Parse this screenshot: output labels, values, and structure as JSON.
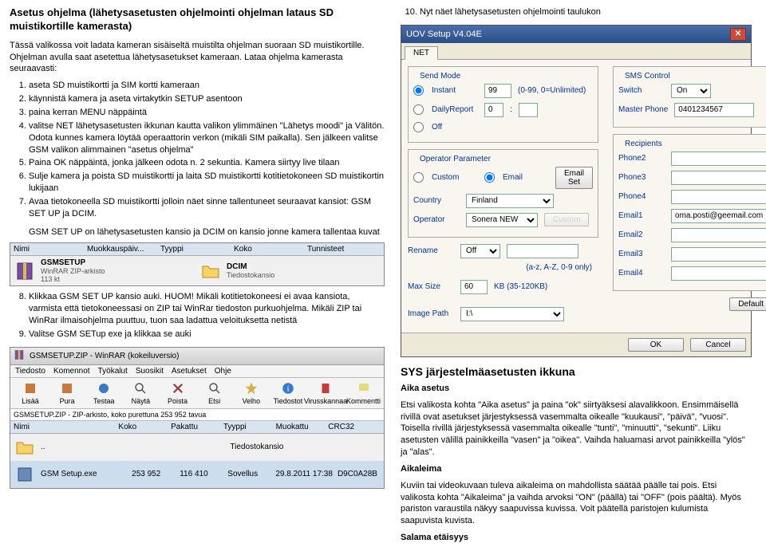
{
  "left": {
    "title": "Asetus ohjelma (lähetysasetusten ohjelmointi ohjelman lataus SD muistikortille kamerasta)",
    "intro": "Tässä valikossa voit ladata kameran sisäiseltä muistilta ohjelman suoraan SD muistikortille. Ohjelman avulla saat asetettua lähetysasetukset kameraan. Lataa ohjelma kamerasta seuraavasti:",
    "steps_a": [
      "aseta SD muistikortti ja SIM kortti kameraan",
      "käynnistä kamera ja aseta virtakytkin SETUP asentoon",
      "paina kerran MENU näppäintä",
      "valitse NET lähetysasetusten ikkunan kautta valikon ylimmäinen \"Lähetys moodi\" ja Välitön. Odota kunnes kamera löytää operaattorin verkon (mikäli SIM paikalla). Sen jälkeen valitse GSM valikon alimmainen \"asetus ohjelma\"",
      "Paina OK näppäintä, jonka jälkeen odota n. 2 sekuntia. Kamera siirtyy live tilaan",
      "Sulje kamera ja poista SD muistikortti ja laita SD muistikortti kotitietokoneen SD muistikortin lukijaan",
      "Avaa tietokoneella SD muistikortti jolloin näet sinne tallentuneet seuraavat kansiot: GSM SET UP ja DCIM."
    ],
    "note_a": "GSM SET UP on lähetysasetusten kansio ja DCIM on kansio jonne kamera tallentaa kuvat",
    "explorer1_cols": [
      "Nimi",
      "Muokkauspäiv...",
      "Tyyppi",
      "Koko",
      "Tunnisteet"
    ],
    "explorer1_rows": [
      {
        "icon": "zip",
        "name": "GSMSETUP",
        "sub1": "WinRAR ZIP-arkisto",
        "sub2": "113 kt"
      },
      {
        "icon": "folder",
        "name": "DCIM",
        "sub1": "Tiedostokansio",
        "sub2": ""
      }
    ],
    "steps_b": [
      "Klikkaa GSM SET UP kansio auki. HUOM! Mikäli kotitietokoneesi ei avaa kansiota, varmista että tietokoneessasi on ZIP tai WinRar tiedoston purkuohjelma. Mikäli ZIP tai WinRar ilmaisohjelma puuttuu, tuon saa ladattua veloituksetta netistä",
      "Valitse GSM SETup exe ja klikkaa se auki"
    ],
    "winrar": {
      "title": "GSMSETUP.ZIP - WinRAR (kokeiluversio)",
      "menu": [
        "Tiedosto",
        "Komennot",
        "Työkalut",
        "Suosikit",
        "Asetukset",
        "Ohje"
      ],
      "tools": [
        "Lisää",
        "Pura",
        "Testaa",
        "Näytä",
        "Poista",
        "Etsi",
        "Velho",
        "Tiedostot",
        "Virusskannaa",
        "Kommentti"
      ],
      "path": "GSMSETUP.ZIP - ZIP-arkisto, koko purettuna 253 952 tavua",
      "cols": [
        "Nimi",
        "Koko",
        "Pakattu",
        "Tyyppi",
        "Muokattu",
        "CRC32"
      ],
      "row_parent": "..",
      "row_parent_type": "Tiedostokansio",
      "row": {
        "name": "GSM Setup.exe",
        "size": "253 952",
        "packed": "116 410",
        "type": "Sovellus",
        "date": "29.8.2011 17:38",
        "crc": "D9C0A28B"
      }
    }
  },
  "right": {
    "step10": "Nyt näet lähetysasetusten ohjelmointi taulukon",
    "uov": {
      "title": "UOV Setup V4.04E",
      "tab": "NET",
      "send_mode_label": "Send Mode",
      "instant_label": "Instant",
      "instant_val": "99",
      "instant_hint": "(0-99, 0=Unlimited)",
      "daily_label": "DailyReport",
      "daily_val": "0",
      "off_label": "Off",
      "sms_group": "SMS Control",
      "switch_label": "Switch",
      "switch_val": "On",
      "master_label": "Master Phone",
      "master_val": "0401234567",
      "operator_group": "Operator Parameter",
      "custom": "Custom",
      "email": "Email",
      "email_set_btn": "Email Set",
      "country_label": "Country",
      "country_val": "Finland",
      "operator_label": "Operator",
      "operator_val": "Sonera NEW",
      "custom_btn": "Custom",
      "recipients_group": "Recipients",
      "phone2": "Phone2",
      "phone3": "Phone3",
      "phone4": "Phone4",
      "rename_label": "Rename",
      "rename_val": "Off",
      "email1": "Email1",
      "email1_val": "oma.posti@geemail.com",
      "note": "(a-z, A-Z, 0-9 only)",
      "email2": "Email2",
      "email3": "Email3",
      "maxsize_label": "Max Size",
      "maxsize_val": "60",
      "maxsize_unit": "KB   (35-120KB)",
      "email4": "Email4",
      "image_path_label": "Image Path",
      "image_path_val": "I:\\",
      "default_btn": "Default",
      "ok_btn": "OK",
      "cancel_btn": "Cancel"
    },
    "sys_title": "SYS järjestelmäasetusten ikkuna",
    "aika_head": "Aika asetus",
    "aika_body": "Etsi valikosta kohta \"Aika asetus\" ja paina \"ok\" siirtyäksesi alavalikkoon. Ensimmäisellä rivillä ovat asetukset järjestyksessä vasemmalta oikealle \"kuukausi\", \"päivä\", \"vuosi\". Toisella rivillä järjestyksessä vasemmalta oikealle \"tunti\", \"minuutti\", \"sekunti\". Liiku asetusten välillä painikkeilla \"vasen\" ja \"oikea\". Vaihda haluamasi arvot painikkeilla \"ylös\" ja \"alas\".",
    "aikaleima_head": "Aikaleima",
    "aikaleima_body": "Kuviin tai videokuvaan tuleva aikaleima on mahdollista säätää päälle tai pois. Etsi valikosta kohta \"Aikaleima\" ja vaihda arvoksi \"ON\" (päällä) tai \"OFF\" (pois päältä). Myös pariston varaustila näkyy saapuvissa kuvissa. Voit päätellä paristojen kulumista saapuvista kuvista.",
    "salama_head": "Salama etäisyys"
  }
}
